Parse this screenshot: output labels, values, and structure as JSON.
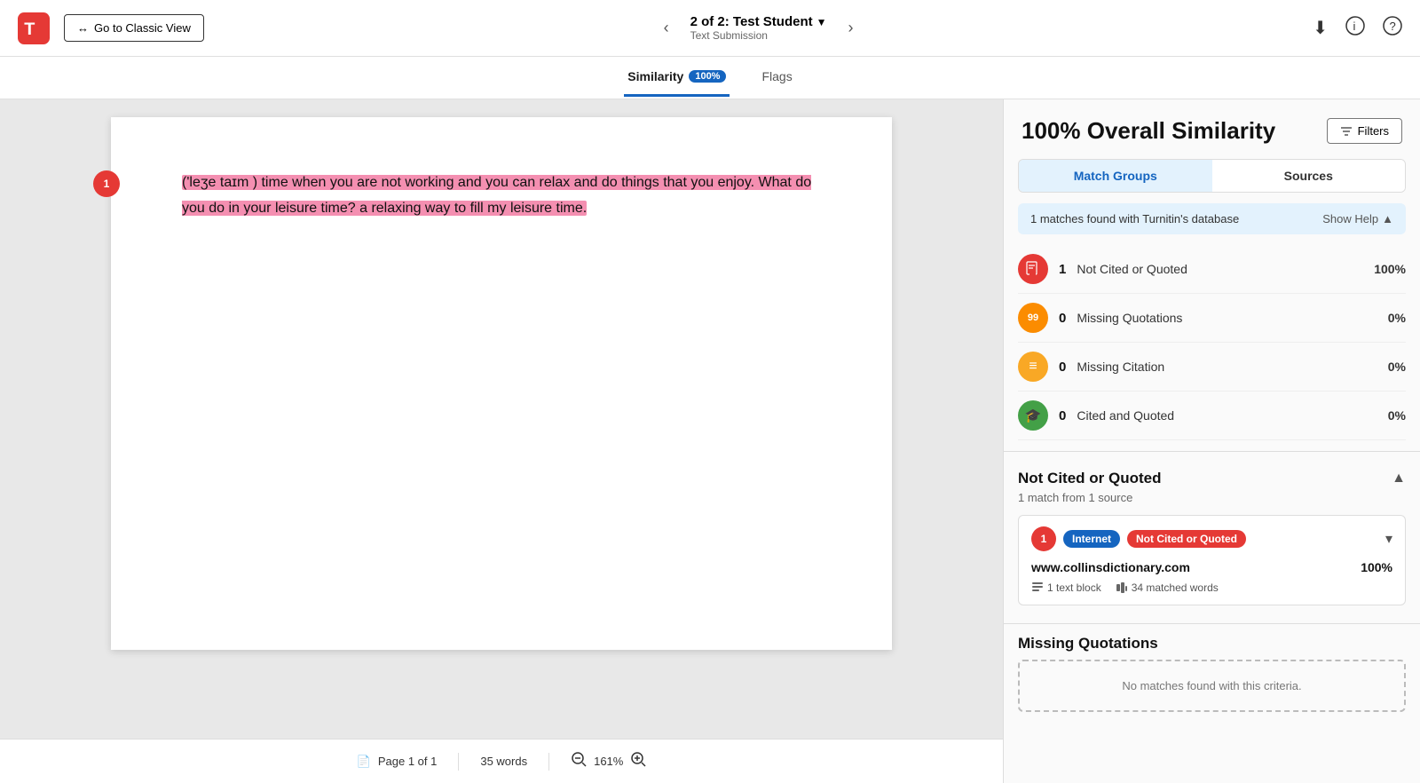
{
  "topbar": {
    "logo_alt": "Turnitin",
    "classic_view_label": "Go to Classic View",
    "student_name": "2 of 2: Test Student",
    "submission_type": "Text Submission",
    "download_icon": "⬇",
    "info_icon": "ℹ",
    "help_icon": "?"
  },
  "tabs": {
    "similarity_label": "Similarity",
    "similarity_badge": "100%",
    "flags_label": "Flags"
  },
  "sidebar": {
    "overall_similarity": "100% Overall Similarity",
    "filters_label": "Filters",
    "match_groups_label": "Match Groups",
    "sources_label": "Sources",
    "matches_found_text": "1 matches found with Turnitin's database",
    "show_help_label": "Show Help",
    "match_rows": [
      {
        "count": "1",
        "label": "Not Cited or Quoted",
        "pct": "100%",
        "icon_type": "red",
        "icon_symbol": "📄"
      },
      {
        "count": "0",
        "label": "Missing Quotations",
        "pct": "0%",
        "icon_type": "orange",
        "icon_symbol": "99"
      },
      {
        "count": "0",
        "label": "Missing Citation",
        "pct": "0%",
        "icon_type": "yellow-dark",
        "icon_symbol": "≡"
      },
      {
        "count": "0",
        "label": "Cited and Quoted",
        "pct": "0%",
        "icon_type": "green",
        "icon_symbol": "🎓"
      }
    ],
    "not_cited_section": {
      "title": "Not Cited or Quoted",
      "subtitle": "1 match from 1 source",
      "source": {
        "badge_num": "1",
        "badge_internet": "Internet",
        "badge_ncq": "Not Cited or Quoted",
        "url": "www.collinsdictionary.com",
        "pct": "100%",
        "text_blocks": "1 text block",
        "matched_words": "34 matched words"
      }
    },
    "missing_quotations": {
      "title": "Missing Quotations",
      "empty_text": "No matches found with this criteria."
    }
  },
  "document": {
    "match_number": "1",
    "page_label": "Page 1 of 1",
    "word_count": "35 words",
    "zoom_level": "161%",
    "text_before": "('leʒe taɪm ) time when you are not working and you can relax and do things that you enjoy. What do you do in your leisure time? a relaxing way to fill my leisure time."
  }
}
